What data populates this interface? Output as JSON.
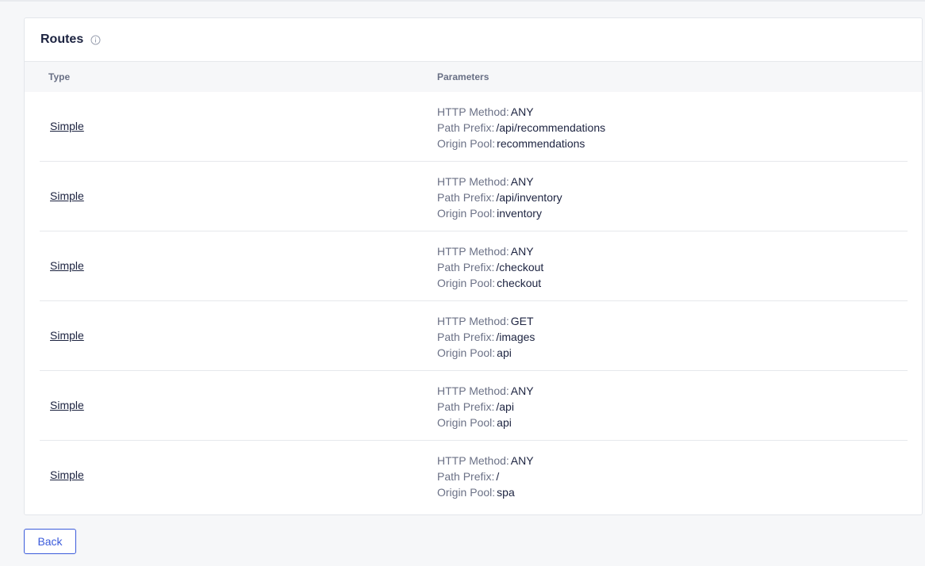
{
  "routes_card": {
    "title": "Routes",
    "info_icon": "info-circle-icon",
    "columns": {
      "type": "Type",
      "parameters": "Parameters"
    },
    "param_labels": {
      "http_method": "HTTP Method:",
      "path_prefix": "Path Prefix:",
      "origin_pool": "Origin Pool:"
    },
    "rows": [
      {
        "type": "Simple",
        "http_method": "ANY",
        "path_prefix": "/api/recommendations",
        "origin_pool": "recommendations"
      },
      {
        "type": "Simple",
        "http_method": "ANY",
        "path_prefix": "/api/inventory",
        "origin_pool": "inventory"
      },
      {
        "type": "Simple",
        "http_method": "ANY",
        "path_prefix": "/checkout",
        "origin_pool": "checkout"
      },
      {
        "type": "Simple",
        "http_method": "GET",
        "path_prefix": "/images",
        "origin_pool": "api"
      },
      {
        "type": "Simple",
        "http_method": "ANY",
        "path_prefix": "/api",
        "origin_pool": "api"
      },
      {
        "type": "Simple",
        "http_method": "ANY",
        "path_prefix": "/",
        "origin_pool": "spa"
      }
    ]
  },
  "footer": {
    "back_label": "Back"
  },
  "colors": {
    "accent": "#3b5bdb",
    "text_primary": "#1c2340",
    "text_muted": "#6b7186"
  }
}
